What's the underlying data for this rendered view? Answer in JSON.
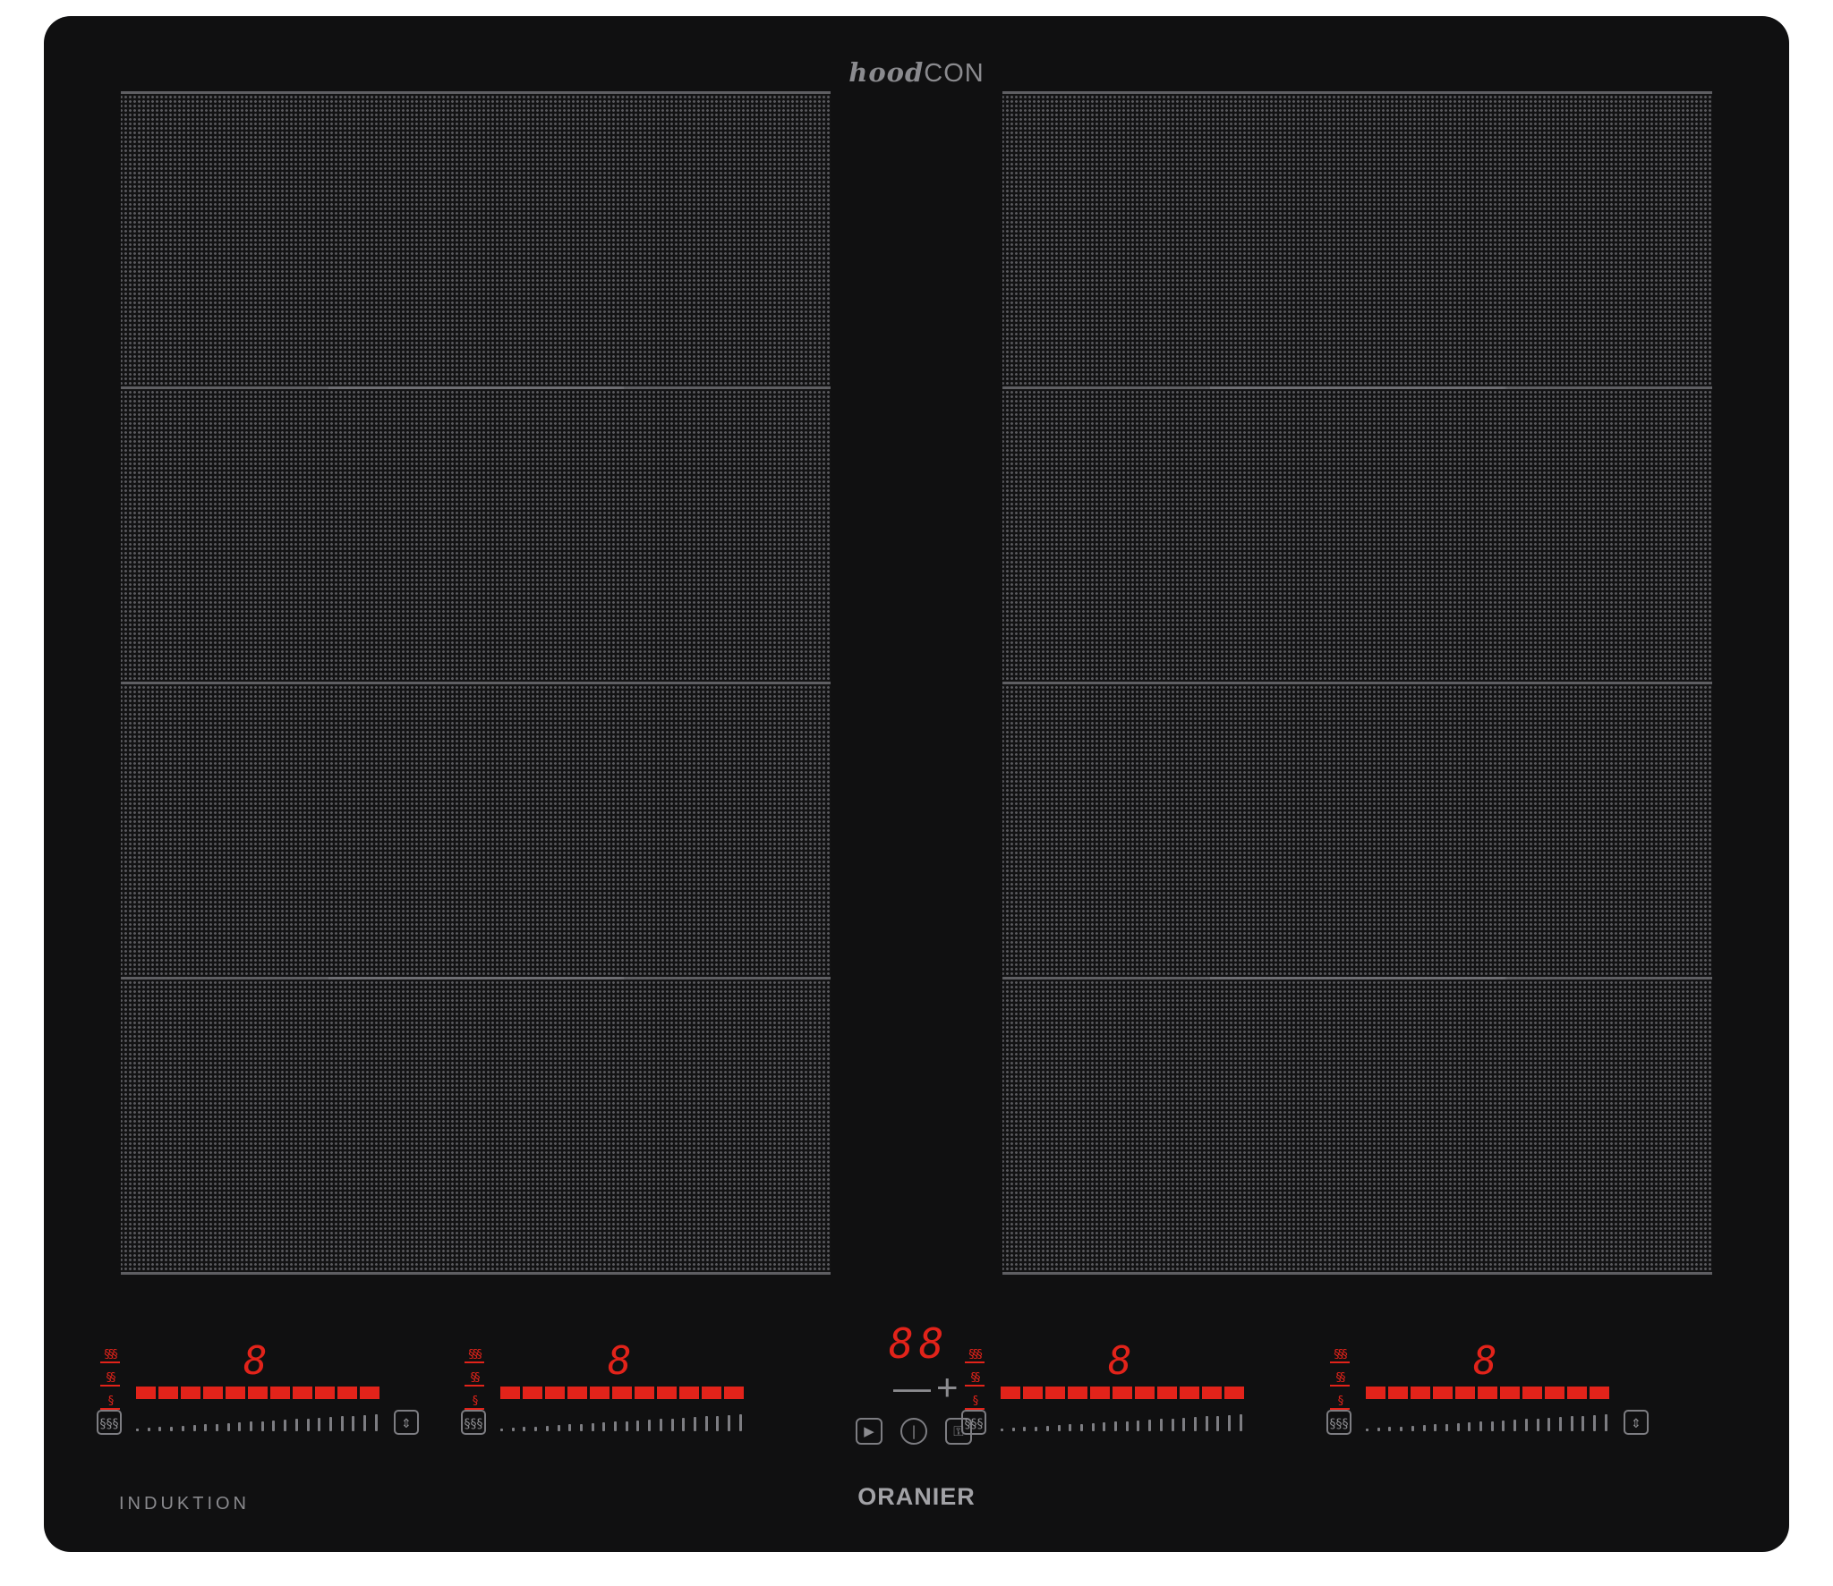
{
  "brand_top": {
    "prefix": "hood",
    "suffix": "CON"
  },
  "brand_bottom": "ORANIER",
  "label_left": "INDUKTION",
  "colors": {
    "display_red": "#e2231a",
    "glass": "#101011",
    "print_grey": "#7d7d82"
  },
  "controls": [
    {
      "digit": "8",
      "power_segments": 11,
      "boost_icon": "boost-icon",
      "bridge_icon": "bridge-icon"
    },
    {
      "digit": "8",
      "power_segments": 11,
      "boost_icon": "boost-icon"
    },
    {
      "digit": "8",
      "power_segments": 11,
      "boost_icon": "boost-icon"
    },
    {
      "digit": "8",
      "power_segments": 11,
      "boost_icon": "boost-icon",
      "bridge_icon": "bridge-icon"
    }
  ],
  "center": {
    "timer": "88",
    "minus": "—",
    "plus": "+",
    "buttons": [
      "play-pause-icon",
      "power-icon",
      "lock-icon"
    ]
  }
}
